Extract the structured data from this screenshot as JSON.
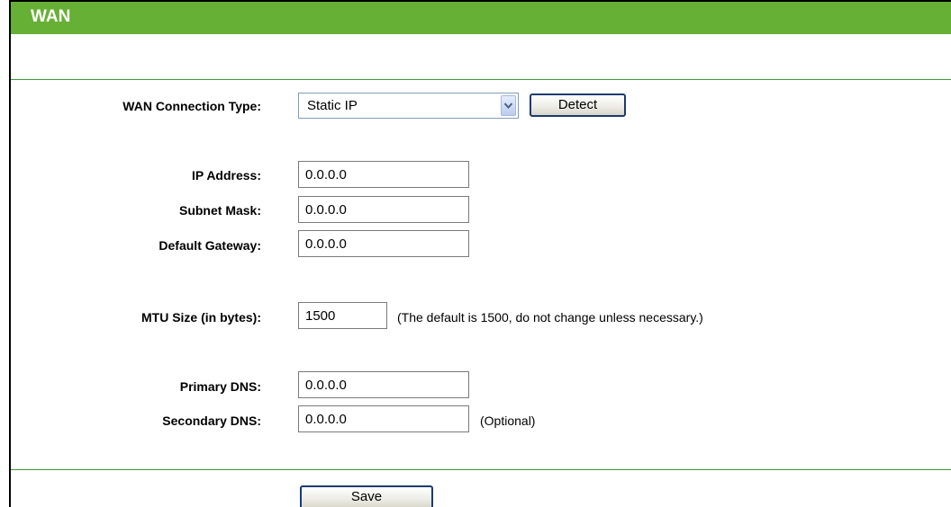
{
  "header": {
    "title": "WAN"
  },
  "connection_type": {
    "label": "WAN Connection Type:",
    "selected": "Static IP",
    "detect_label": "Detect"
  },
  "fields": {
    "ip_address": {
      "label": "IP Address:",
      "value": "0.0.0.0"
    },
    "subnet_mask": {
      "label": "Subnet Mask:",
      "value": "0.0.0.0"
    },
    "default_gateway": {
      "label": "Default Gateway:",
      "value": "0.0.0.0"
    },
    "mtu": {
      "label": "MTU Size (in bytes):",
      "value": "1500",
      "note": "(The default is 1500, do not change unless necessary.)"
    },
    "primary_dns": {
      "label": "Primary DNS:",
      "value": "0.0.0.0"
    },
    "secondary_dns": {
      "label": "Secondary DNS:",
      "value": "0.0.0.0",
      "note": "(Optional)"
    }
  },
  "actions": {
    "save_label": "Save"
  },
  "colors": {
    "title_bar": "#66b035",
    "rule": "#3f9a3b",
    "button_border": "#1c3a70"
  },
  "icons": {
    "select_arrow": "chevron-down-icon"
  }
}
